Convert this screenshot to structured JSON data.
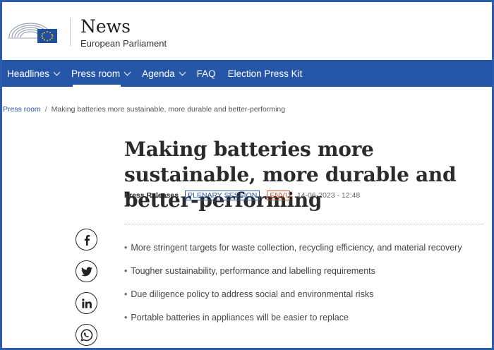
{
  "header": {
    "title": "News",
    "subtitle": "European Parliament",
    "logo": "european-parliament-logo"
  },
  "nav": {
    "items": [
      {
        "label": "Headlines",
        "has_dropdown": true
      },
      {
        "label": "Press room",
        "has_dropdown": true,
        "active": true
      },
      {
        "label": "Agenda",
        "has_dropdown": true
      },
      {
        "label": "FAQ",
        "has_dropdown": false
      },
      {
        "label": "Election Press Kit",
        "has_dropdown": false
      }
    ]
  },
  "breadcrumb": {
    "root": "Press room",
    "separator": "/",
    "current": "Making batteries more sustainable, more durable and better-performing"
  },
  "article": {
    "title": "Making batteries more sustainable, more durable and better-performing",
    "category": "Press Releases",
    "tags": [
      "PLENARY SESSION",
      "ENVI"
    ],
    "date": "14-06-2023 - 12:48",
    "bullets": [
      "More stringent targets for waste collection, recycling efficiency, and material recovery",
      "Tougher sustainability, performance and labelling requirements",
      "Due diligence policy to address social and environmental risks",
      "Portable batteries in appliances will be easier to replace"
    ]
  },
  "share": {
    "icons": [
      "facebook-icon",
      "twitter-icon",
      "linkedin-icon",
      "whatsapp-icon"
    ]
  },
  "colors": {
    "nav_bg": "#2556a8",
    "tag_plenary": "#2556a8",
    "tag_envi": "#d1522b",
    "frame_border": "#2a5db0"
  }
}
